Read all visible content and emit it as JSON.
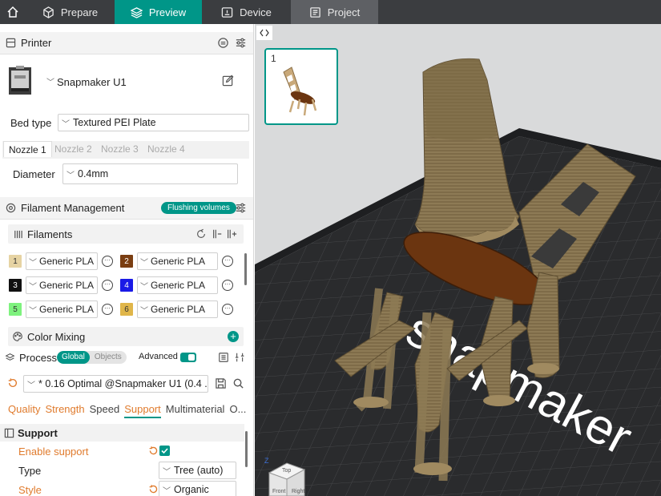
{
  "topbar": {
    "tabs": [
      {
        "label": "Prepare"
      },
      {
        "label": "Preview"
      },
      {
        "label": "Device"
      },
      {
        "label": "Project"
      }
    ]
  },
  "printer": {
    "section_title": "Printer",
    "name": "Snapmaker U1",
    "bed_type_label": "Bed type",
    "bed_type_value": "Textured PEI Plate",
    "nozzle_tabs": [
      "Nozzle 1",
      "Nozzle 2",
      "Nozzle 3",
      "Nozzle 4"
    ],
    "diameter_label": "Diameter",
    "diameter_value": "0.4mm"
  },
  "filament": {
    "section_title": "Filament Management",
    "flushing_button": "Flushing volumes",
    "filaments_title": "Filaments",
    "items": [
      {
        "num": "1",
        "name": "Generic PLA",
        "color": "#e6d3a3",
        "text_color": "#333"
      },
      {
        "num": "2",
        "name": "Generic PLA",
        "color": "#7a3e12",
        "text_color": "#fff"
      },
      {
        "num": "3",
        "name": "Generic PLA",
        "color": "#111111",
        "text_color": "#fff"
      },
      {
        "num": "4",
        "name": "Generic PLA",
        "color": "#1a1ae6",
        "text_color": "#fff"
      },
      {
        "num": "5",
        "name": "Generic PLA",
        "color": "#7ef27e",
        "text_color": "#333"
      },
      {
        "num": "6",
        "name": "Generic PLA",
        "color": "#e0b64a",
        "text_color": "#333"
      }
    ],
    "color_mixing": "Color Mixing"
  },
  "process": {
    "section_title": "Process",
    "seg_global": "Global",
    "seg_objects": "Objects",
    "advanced_label": "Advanced",
    "profile": "* 0.16 Optimal @Snapmaker U1 (0.4 ...",
    "tabs": [
      "Quality",
      "Strength",
      "Speed",
      "Support",
      "Multimaterial",
      "O..."
    ],
    "support_group": "Support",
    "rows": [
      {
        "label": "Enable support"
      },
      {
        "label": "Type",
        "value": "Tree (auto)"
      },
      {
        "label": "Style",
        "value": "Organic"
      }
    ]
  },
  "viewport": {
    "plate_number": "1",
    "brand_text": "snapmaker",
    "cube_labels": {
      "top": "Top",
      "front": "Front",
      "right": "Right"
    },
    "axis_z": "Z"
  },
  "colors": {
    "accent": "#009688",
    "topbar": "#3b3d40",
    "support_orange": "#e07b2d",
    "print_brown": "#8a7450",
    "seat_brown": "#6b3510",
    "bed": "#2a2b2d"
  }
}
